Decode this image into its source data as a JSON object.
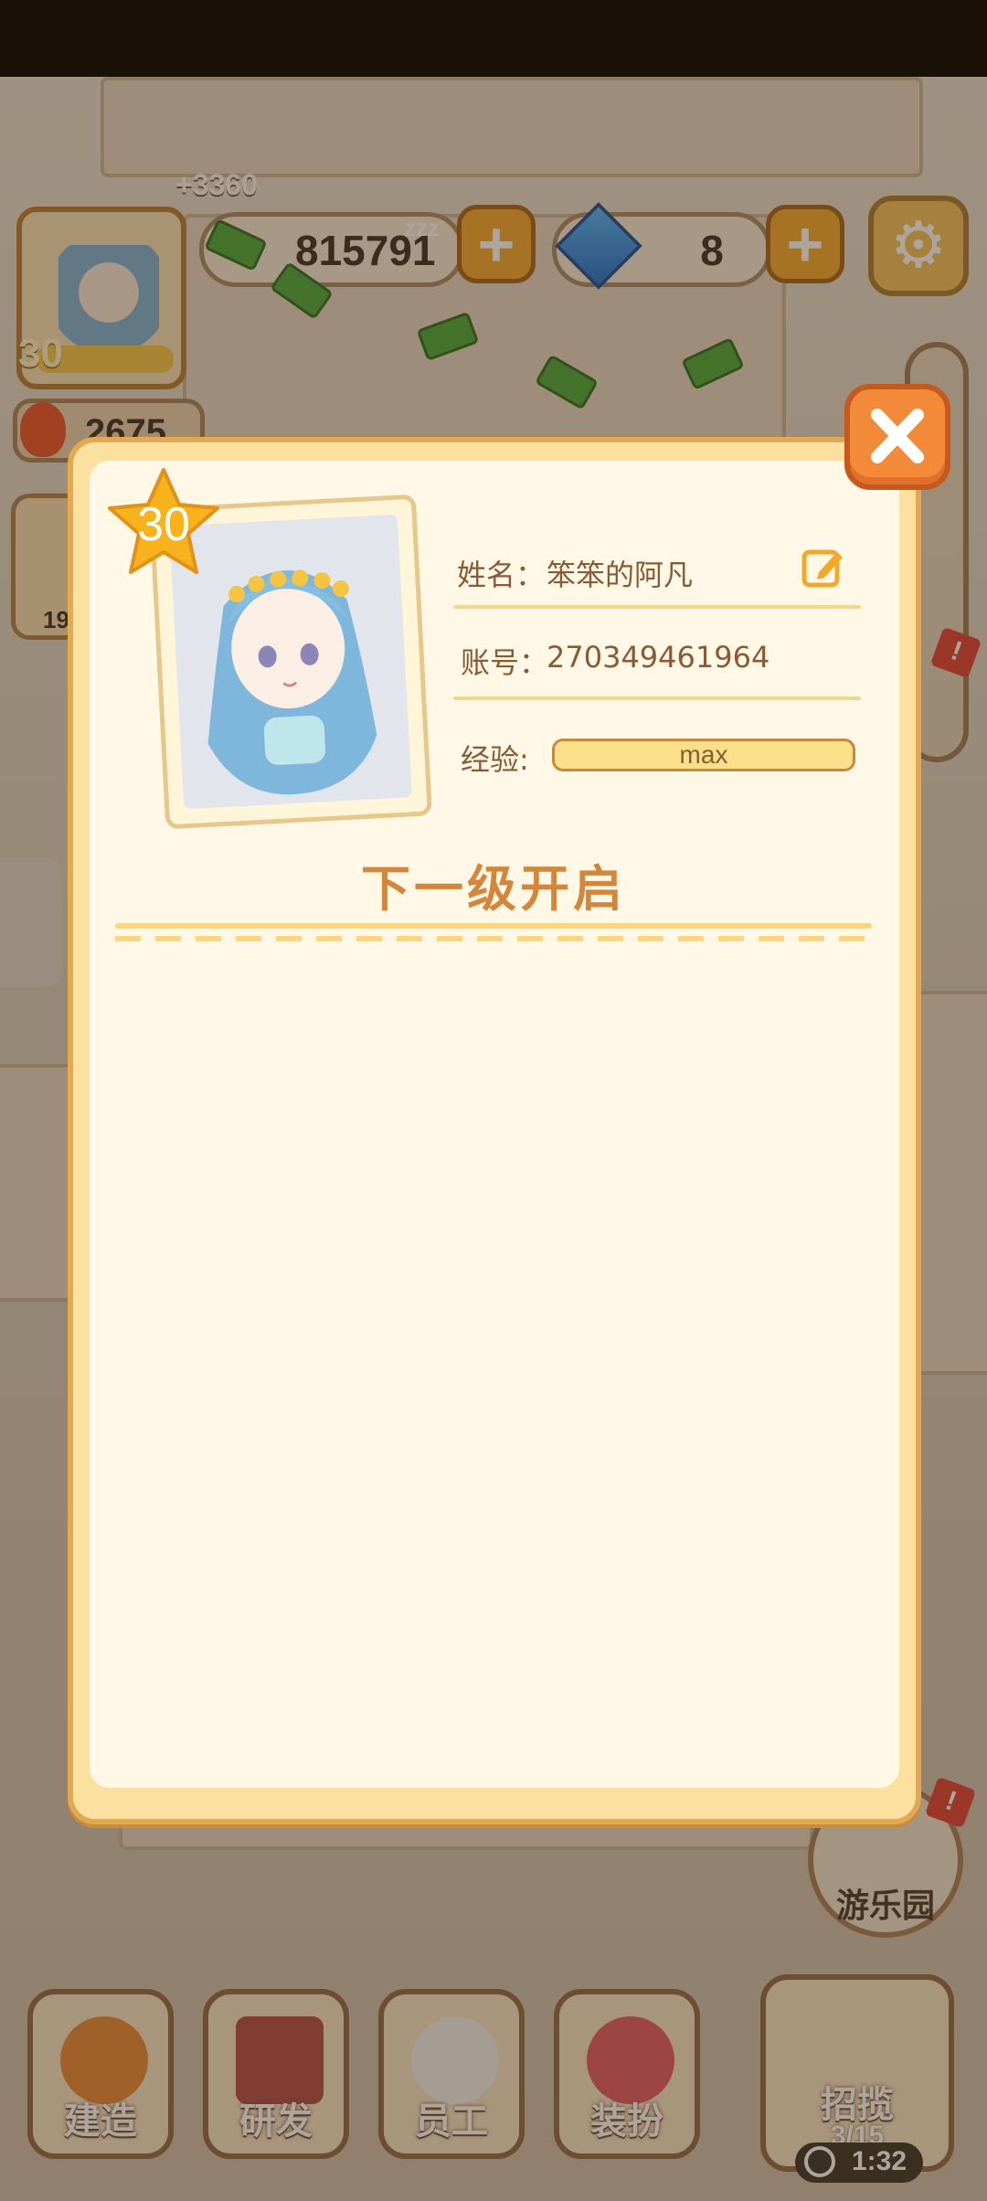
{
  "hud": {
    "player_level": "30",
    "income_gain": "+3360",
    "money": "815791",
    "gems": "8",
    "heat": "2675",
    "side_count": "19",
    "amusement_park": "游乐园"
  },
  "bottom_nav": [
    {
      "label": "建造",
      "icon": "helmet-icon"
    },
    {
      "label": "研发",
      "icon": "book-icon"
    },
    {
      "label": "员工",
      "icon": "chef-icon"
    },
    {
      "label": "装扮",
      "icon": "bow-icon"
    }
  ],
  "recruit": {
    "label": "招揽",
    "count": "3/15",
    "timer": "1:32"
  },
  "profile": {
    "level": "30",
    "name_label": "姓名：",
    "name_value": "笨笨的阿凡",
    "account_label": "账号：",
    "account_value": "270349461964",
    "exp_label": "经验:",
    "exp_value": "max",
    "next_level_title": "下一级开启"
  },
  "colors": {
    "modal_fill": "#fff8e6",
    "modal_border": "#e3a852",
    "accent_orange": "#d4873a",
    "close_button": "#f28a3a"
  }
}
